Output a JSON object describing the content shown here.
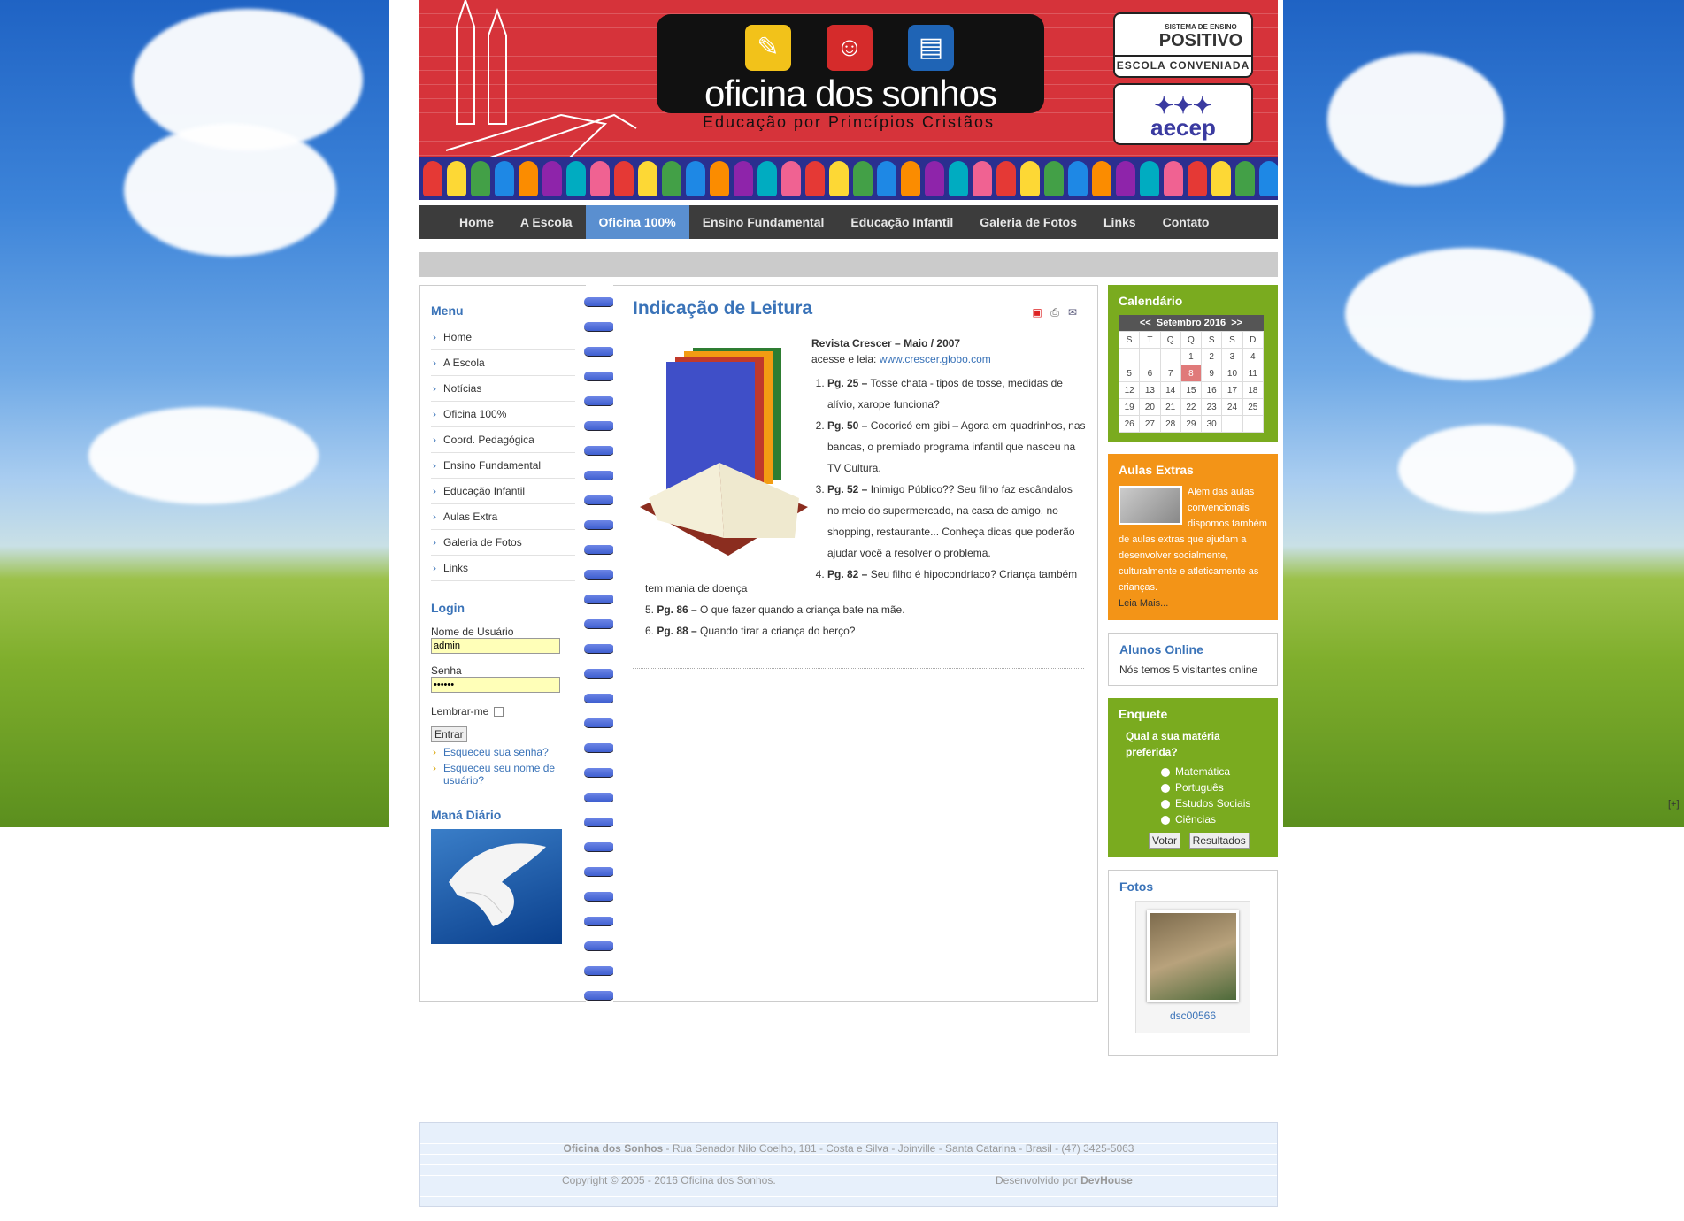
{
  "header": {
    "logo_title": "oficina dos sonhos",
    "logo_subtitle": "Educação por Princípios Cristãos",
    "badge1_top": "SISTEMA DE ENSINO",
    "badge1_name": "POSITIVO",
    "badge1_bottom": "ESCOLA CONVENIADA",
    "badge2_name": "aecep"
  },
  "nav": [
    "Home",
    "A Escola",
    "Oficina 100%",
    "Ensino Fundamental",
    "Educação Infantil",
    "Galeria de Fotos",
    "Links",
    "Contato"
  ],
  "left": {
    "menu_title": "Menu",
    "menu": [
      "Home",
      "A Escola",
      "Notícias",
      "Oficina 100%",
      "Coord. Pedagógica",
      "Ensino Fundamental",
      "Educação Infantil",
      "Aulas Extra",
      "Galeria de Fotos",
      "Links"
    ],
    "login_title": "Login",
    "username_label": "Nome de Usuário",
    "username_value": "admin",
    "password_label": "Senha",
    "password_value": "••••••",
    "remember_label": "Lembrar-me",
    "submit": "Entrar",
    "forgot_pass": "Esqueceu sua senha?",
    "forgot_user": "Esqueceu seu nome de usuário?",
    "mana_title": "Maná Diário"
  },
  "article": {
    "title": "Indicação de Leitura",
    "source": "Revista Crescer – Maio / 2007",
    "access_prefix": "acesse e leia: ",
    "access_link": "www.crescer.globo.com",
    "items": [
      {
        "page": "Pg. 25 –",
        "text": " Tosse chata - tipos de tosse, medidas de alívio, xarope funciona?"
      },
      {
        "page": "Pg. 50 –",
        "text": " Cocoricó em gibi – Agora em quadrinhos, nas bancas, o premiado programa infantil que nasceu na TV Cultura."
      },
      {
        "page": "Pg. 52 –",
        "text": " Inimigo Público?? Seu filho faz escândalos no meio do supermercado, na casa de amigo, no shopping, restaurante... Conheça dicas que poderão ajudar você a resolver o problema."
      },
      {
        "page": "Pg. 82 –",
        "text": " Seu filho é hipocondríaco? Criança também"
      },
      {
        "page": "Pg. 86 –",
        "text": " O que fazer quando a criança bate na mãe."
      },
      {
        "page": "Pg. 88 –",
        "text": " Quando tirar a criança do berço?"
      }
    ],
    "item4_continued": "tem mania de doença"
  },
  "calendar": {
    "title": "Calendário",
    "month": "Setembro 2016",
    "prev": "<<",
    "next": ">>",
    "weekdays": [
      "S",
      "T",
      "Q",
      "Q",
      "S",
      "S",
      "D"
    ],
    "weeks": [
      [
        "",
        "",
        "",
        "1",
        "2",
        "3",
        "4"
      ],
      [
        "5",
        "6",
        "7",
        "8",
        "9",
        "10",
        "11"
      ],
      [
        "12",
        "13",
        "14",
        "15",
        "16",
        "17",
        "18"
      ],
      [
        "19",
        "20",
        "21",
        "22",
        "23",
        "24",
        "25"
      ],
      [
        "26",
        "27",
        "28",
        "29",
        "30",
        "",
        ""
      ]
    ],
    "today": "8"
  },
  "aulas": {
    "title": "Aulas Extras",
    "text": "Além das aulas convencionais dispomos também de aulas extras que ajudam a desenvolver socialmente, culturalmente e atleticamente as crianças.",
    "more": "Leia Mais..."
  },
  "online": {
    "title": "Alunos Online",
    "text": "Nós temos 5 visitantes online"
  },
  "poll": {
    "title": "Enquete",
    "question": "Qual a sua matéria preferida?",
    "options": [
      "Matemática",
      "Português",
      "Estudos Sociais",
      "Ciências"
    ],
    "vote": "Votar",
    "results": "Resultados"
  },
  "fotos": {
    "title": "Fotos",
    "caption": "dsc00566"
  },
  "footer": {
    "name": "Oficina dos Sonhos",
    "address": " - Rua Senador Nilo Coelho, 181 - Costa e Silva - Joinville - Santa Catarina - Brasil - (47) 3425-5063",
    "copyright": "Copyright © 2005 - 2016 Oficina dos Sonhos.",
    "dev_prefix": "Desenvolvido por ",
    "dev_name": "DevHouse"
  },
  "corner_toggle": "[+]",
  "colors": {
    "header_red": "#d6333a",
    "nav_active": "#5a8fd0",
    "green_box": "#7aab1f",
    "orange_box": "#f39417",
    "link_blue": "#3a73b8"
  }
}
